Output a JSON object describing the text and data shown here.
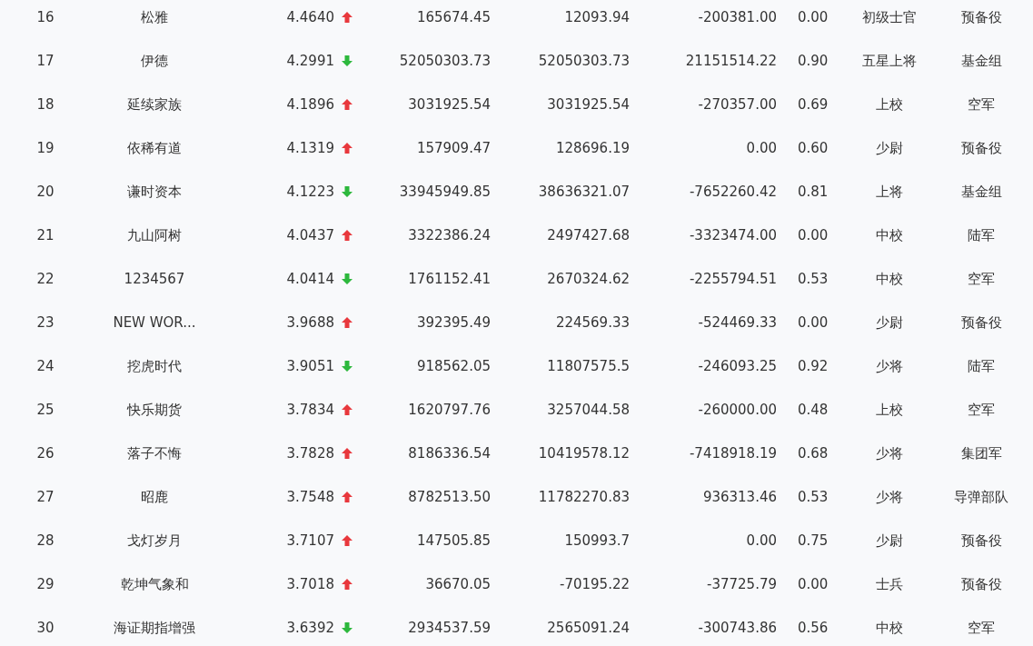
{
  "rows": [
    {
      "rank": "16",
      "name": "松雅",
      "score": "4.4640",
      "kind": "up",
      "column_4": "165674.45",
      "column_5": "12093.94",
      "column_6": "-200381.00",
      "column_7": "0.00",
      "title": "初级士官",
      "group": "预备役"
    },
    {
      "rank": "17",
      "name": "伊德",
      "score": "4.2991",
      "kind": "down",
      "column_4": "52050303.73",
      "column_5": "52050303.73",
      "column_6": "21151514.22",
      "column_7": "0.90",
      "title": "五星上将",
      "group": "基金组"
    },
    {
      "rank": "18",
      "name": "延续家族",
      "score": "4.1896",
      "kind": "up",
      "column_4": "3031925.54",
      "column_5": "3031925.54",
      "column_6": "-270357.00",
      "column_7": "0.69",
      "title": "上校",
      "group": "空军"
    },
    {
      "rank": "19",
      "name": "依稀有道",
      "score": "4.1319",
      "kind": "up",
      "column_4": "157909.47",
      "column_5": "128696.19",
      "column_6": "0.00",
      "column_7": "0.60",
      "title": "少尉",
      "group": "预备役"
    },
    {
      "rank": "20",
      "name": "谦时资本",
      "score": "4.1223",
      "kind": "down",
      "column_4": "33945949.85",
      "column_5": "38636321.07",
      "column_6": "-7652260.42",
      "column_7": "0.81",
      "title": "上将",
      "group": "基金组"
    },
    {
      "rank": "21",
      "name": "九山阿树",
      "score": "4.0437",
      "kind": "up",
      "column_4": "3322386.24",
      "column_5": "2497427.68",
      "column_6": "-3323474.00",
      "column_7": "0.00",
      "title": "中校",
      "group": "陆军"
    },
    {
      "rank": "22",
      "name": "1234567",
      "score": "4.0414",
      "kind": "down",
      "column_4": "1761152.41",
      "column_5": "2670324.62",
      "column_6": "-2255794.51",
      "column_7": "0.53",
      "title": "中校",
      "group": "空军"
    },
    {
      "rank": "23",
      "name": "NEW WOR...",
      "score": "3.9688",
      "kind": "up",
      "column_4": "392395.49",
      "column_5": "224569.33",
      "column_6": "-524469.33",
      "column_7": "0.00",
      "title": "少尉",
      "group": "预备役"
    },
    {
      "rank": "24",
      "name": "挖虎时代",
      "score": "3.9051",
      "kind": "down",
      "column_4": "918562.05",
      "column_5": "11807575.5",
      "column_6": "-246093.25",
      "column_7": "0.92",
      "title": "少将",
      "group": "陆军"
    },
    {
      "rank": "25",
      "name": "快乐期货",
      "score": "3.7834",
      "kind": "up",
      "column_4": "1620797.76",
      "column_5": "3257044.58",
      "column_6": "-260000.00",
      "column_7": "0.48",
      "title": "上校",
      "group": "空军"
    },
    {
      "rank": "26",
      "name": "落子不悔",
      "score": "3.7828",
      "kind": "up",
      "column_4": "8186336.54",
      "column_5": "10419578.12",
      "column_6": "-7418918.19",
      "column_7": "0.68",
      "title": "少将",
      "group": "集团军"
    },
    {
      "rank": "27",
      "name": "昭鹿",
      "score": "3.7548",
      "kind": "up",
      "column_4": "8782513.50",
      "column_5": "11782270.83",
      "column_6": "936313.46",
      "column_7": "0.53",
      "title": "少将",
      "group": "导弹部队"
    },
    {
      "rank": "28",
      "name": "戈灯岁月",
      "score": "3.7107",
      "kind": "up",
      "column_4": "147505.85",
      "column_5": "150993.7",
      "column_6": "0.00",
      "column_7": "0.75",
      "title": "少尉",
      "group": "预备役"
    },
    {
      "rank": "29",
      "name": "乾坤气象和",
      "score": "3.7018",
      "kind": "up",
      "column_4": "36670.05",
      "column_5": "-70195.22",
      "column_6": "-37725.79",
      "column_7": "0.00",
      "title": "士兵",
      "group": "预备役"
    },
    {
      "rank": "30",
      "name": "海证期指增强",
      "score": "3.6392",
      "kind": "down",
      "column_4": "2934537.59",
      "column_5": "2565091.24",
      "column_6": "-300743.86",
      "column_7": "0.56",
      "title": "中校",
      "group": "空军"
    }
  ]
}
